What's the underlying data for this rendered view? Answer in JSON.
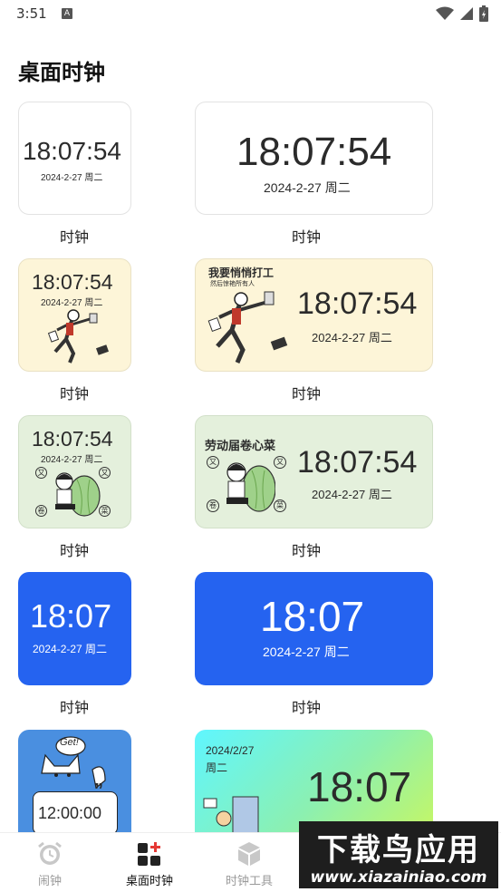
{
  "status_bar": {
    "time": "3:51",
    "notification_icon": "A"
  },
  "page_title": "桌面时钟",
  "widgets": {
    "caption": "时钟",
    "white_small": {
      "time": "18:07:54",
      "date": "2024-2-27 周二"
    },
    "white_large": {
      "time": "18:07:54",
      "date": "2024-2-27 周二"
    },
    "cream_small": {
      "time": "18:07:54",
      "date": "2024-2-27 周二"
    },
    "cream_large": {
      "time": "18:07:54",
      "date": "2024-2-27 周二",
      "headline": "我要悄悄打工",
      "subline": "然后惊艳所有人"
    },
    "green_small": {
      "time": "18:07:54",
      "date": "2024-2-27 周二",
      "badges": [
        "又",
        "又",
        "卷",
        "菜"
      ]
    },
    "green_large": {
      "time": "18:07:54",
      "date": "2024-2-27 周二",
      "headline": "劳动届卷心菜",
      "badges": [
        "又",
        "又",
        "卷",
        "菜"
      ]
    },
    "blue_small": {
      "time": "18:07",
      "date": "2024-2-27 周二"
    },
    "blue_large": {
      "time": "18:07",
      "date": "2024-2-27 周二"
    },
    "cat_small": {
      "time": "12:00:00",
      "bubble": "Get!",
      "quote": "”"
    },
    "grad_large": {
      "date": "2024/2/27",
      "weekday": "周二",
      "time": "18:07"
    }
  },
  "bottom_nav": [
    {
      "label": "闹钟",
      "icon": "alarm-clock-icon",
      "active": false
    },
    {
      "label": "桌面时钟",
      "icon": "widget-add-icon",
      "active": true
    },
    {
      "label": "时钟工具",
      "icon": "cube-icon",
      "active": false
    }
  ],
  "watermark": {
    "line1": "下载鸟应用",
    "line2": "www.xiazainiao.com"
  },
  "colors": {
    "accent_blue": "#2563f0",
    "cream": "#fdf5d8",
    "green": "#e4f0dc",
    "nav_badge": "#e53935"
  }
}
